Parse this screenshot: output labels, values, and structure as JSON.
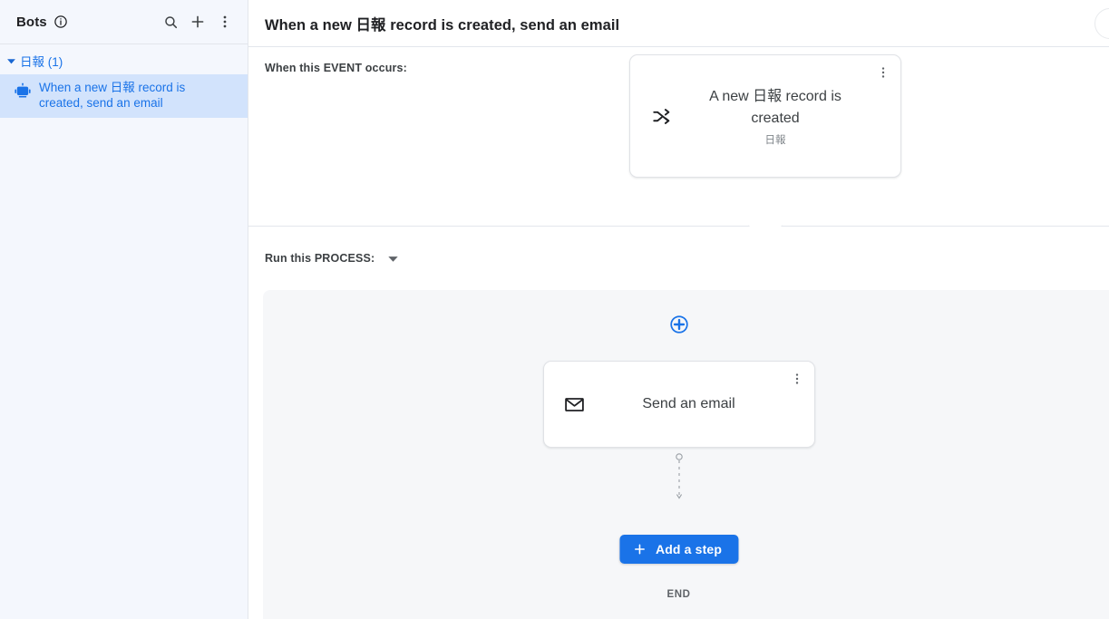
{
  "sidebar": {
    "title": "Bots",
    "info_icon": "info-icon",
    "actions": [
      {
        "name": "search-icon",
        "label": "Search"
      },
      {
        "name": "add-icon",
        "label": "Add"
      },
      {
        "name": "more-vert-icon",
        "label": "More options"
      }
    ],
    "group": {
      "label": "日報 (1)",
      "expanded": true
    },
    "bots": [
      {
        "label": "When a new 日報 record is created, send an email",
        "icon": "robot-icon",
        "selected": true
      }
    ]
  },
  "header": {
    "title": "When a new 日報 record is created, send an email",
    "avatar": "user-avatar"
  },
  "event_section": {
    "label": "When this EVENT occurs:",
    "card": {
      "icon": "shuffle-icon",
      "title": "A new 日報 record is created",
      "subtitle": "日報",
      "menu_icon": "more-vert-icon"
    }
  },
  "process_section": {
    "label": "Run this PROCESS:",
    "dropdown_icon": "chevron-down-icon",
    "add_branch_icon": "add-circle-icon",
    "step": {
      "icon": "email-icon",
      "title": "Send an email",
      "menu_icon": "more-vert-icon"
    },
    "connector_icon": "dashed-arrow-connector",
    "add_step_button": {
      "label": "Add a step",
      "icon": "plus-icon"
    },
    "end_label": "END"
  },
  "colors": {
    "accent": "#1a73e8",
    "sidebar_bg": "#f4f7fd",
    "selected_item_bg": "#d2e3fc",
    "canvas_bg": "#f6f7f9",
    "border": "#e3e6ec",
    "text_primary": "#202124",
    "text_secondary": "#3c4043",
    "text_muted": "#80868b"
  }
}
